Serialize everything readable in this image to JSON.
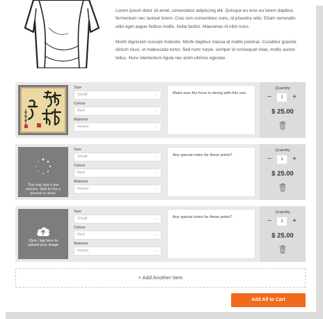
{
  "description": {
    "paragraph_1": "Lorem ipsum dolor sit amet, consectetur adipiscing elit. Quisque eu eros eu lorem dapibus fermentum nec laoreet lorem. Cras non consectetur nunc, id pharetra odio. Etiam venenatis odio eget augue finibus mollis. Nulla facilisi. Maecenas id nibh nunc.",
    "paragraph_2": "Morbi dignissim suscipit molestie. Morbi dapibus massa at mattis pulvinar. Curabitur gravida dictum risus, ut malesuada tortor. Sed nunc turpis, semper id consequat vitae, mollis auctor tellus. Nunc elementum ligula nec enim ultrices egestas."
  },
  "labels": {
    "size": "Size",
    "colour": "Colour",
    "material": "Material",
    "quantity": "Quantity"
  },
  "items": [
    {
      "size": "Small",
      "colour": "Red",
      "material": "Heavy",
      "notes": "Make sure the force is strong with this one.",
      "qty": "1",
      "price": "$ 25.00"
    },
    {
      "size": "Small",
      "colour": "Red",
      "material": "Heavy",
      "notes": "Any special notes for these prints?",
      "qty": "1",
      "price": "$ 25.00",
      "processing_text": "This may take a few minutes. Wait for the a preview to show."
    },
    {
      "size": "Small",
      "colour": "Red",
      "material": "Heavy",
      "notes": "Any special notes for these prints?",
      "qty": "1",
      "price": "$ 25.00",
      "upload_text": "Click / tap here to upload your image"
    }
  ],
  "add_item_label": "+ Add Another Item",
  "add_all_label": "Add All to Cart",
  "colors": {
    "accent": "#f26a1b",
    "panel": "#e9e9e9",
    "price_panel": "#dcdcdc"
  }
}
